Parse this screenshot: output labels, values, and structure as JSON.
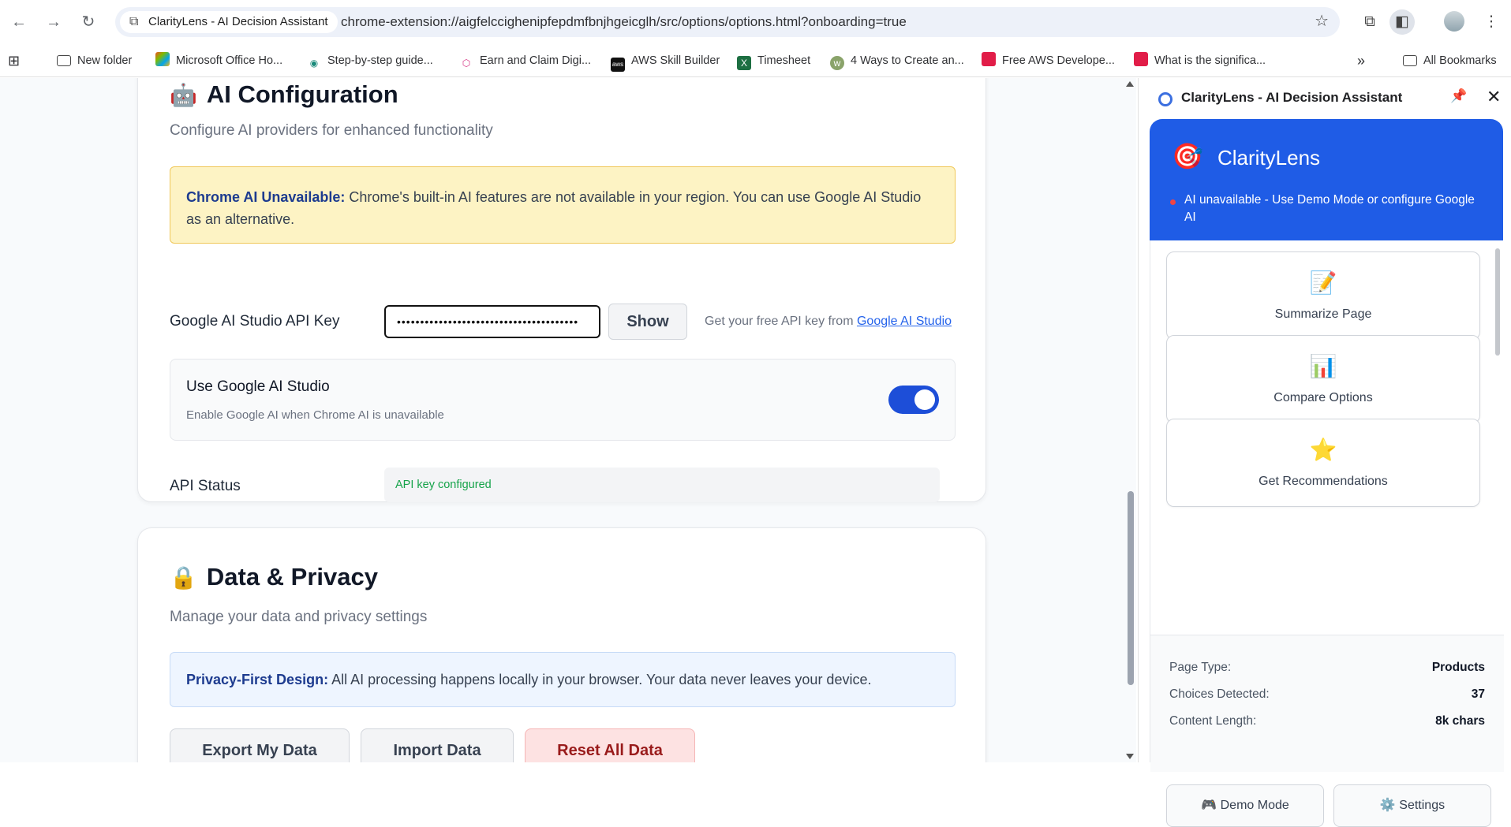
{
  "browser": {
    "tab_title": "ClarityLens - AI Decision Assistant",
    "url": "chrome-extension://aigfelccighenipfepdmfbnjhgeicglh/src/options/options.html?onboarding=true",
    "bookmarks": [
      {
        "label": "New folder",
        "icon": "folder-icon"
      },
      {
        "label": "Microsoft Office Ho...",
        "icon": "office-icon"
      },
      {
        "label": "Step-by-step guide...",
        "icon": "eye-icon"
      },
      {
        "label": "Earn and Claim Digi...",
        "icon": "cube-icon"
      },
      {
        "label": "AWS Skill Builder",
        "icon": "aws-icon"
      },
      {
        "label": "Timesheet",
        "icon": "excel-icon"
      },
      {
        "label": "4 Ways to Create an...",
        "icon": "wiki-icon"
      },
      {
        "label": "Free AWS Develope...",
        "icon": "shield-icon"
      },
      {
        "label": "What is the significa...",
        "icon": "shield-icon"
      }
    ],
    "all_bookmarks": "All Bookmarks"
  },
  "ai_config": {
    "title": "AI Configuration",
    "subtitle": "Configure AI providers for enhanced functionality",
    "warning_strong": "Chrome AI Unavailable:",
    "warning_text": " Chrome's built-in AI features are not available in your region. You can use Google AI Studio as an alternative.",
    "api_key_label": "Google AI Studio API Key",
    "api_key_value": "•••••••••••••••••••••••••••••••••••••••",
    "show_label": "Show",
    "api_hint_prefix": "Get your free API key from ",
    "api_hint_link": "Google AI Studio",
    "toggle_title": "Use Google AI Studio",
    "toggle_desc": "Enable Google AI when Chrome AI is unavailable",
    "toggle_on": true,
    "status_label": "API Status",
    "status_value": "API key configured"
  },
  "privacy": {
    "title": "Data & Privacy",
    "subtitle": "Manage your data and privacy settings",
    "info_strong": "Privacy-First Design:",
    "info_text": " All AI processing happens locally in your browser. Your data never leaves your device.",
    "export_label": "Export My Data",
    "import_label": "Import Data",
    "reset_label": "Reset All Data"
  },
  "side_panel": {
    "header_title": "ClarityLens - AI Decision Assistant",
    "brand": "ClarityLens",
    "status_msg": "AI unavailable - Use Demo Mode or configure Google AI",
    "features": [
      {
        "label": "Summarize Page",
        "icon": "memo-icon"
      },
      {
        "label": "Compare Options",
        "icon": "bar-chart-icon"
      },
      {
        "label": "Get Recommendations",
        "icon": "star-icon"
      }
    ],
    "stats": [
      {
        "key": "Page Type:",
        "value": "Products"
      },
      {
        "key": "Choices Detected:",
        "value": "37"
      },
      {
        "key": "Content Length:",
        "value": "8k chars"
      }
    ],
    "demo_label": "Demo Mode",
    "settings_label": "Settings"
  },
  "colors": {
    "accent": "#1f5ce6",
    "toggle": "#1d4ed8",
    "success": "#16a34a",
    "danger": "#991b1b"
  }
}
